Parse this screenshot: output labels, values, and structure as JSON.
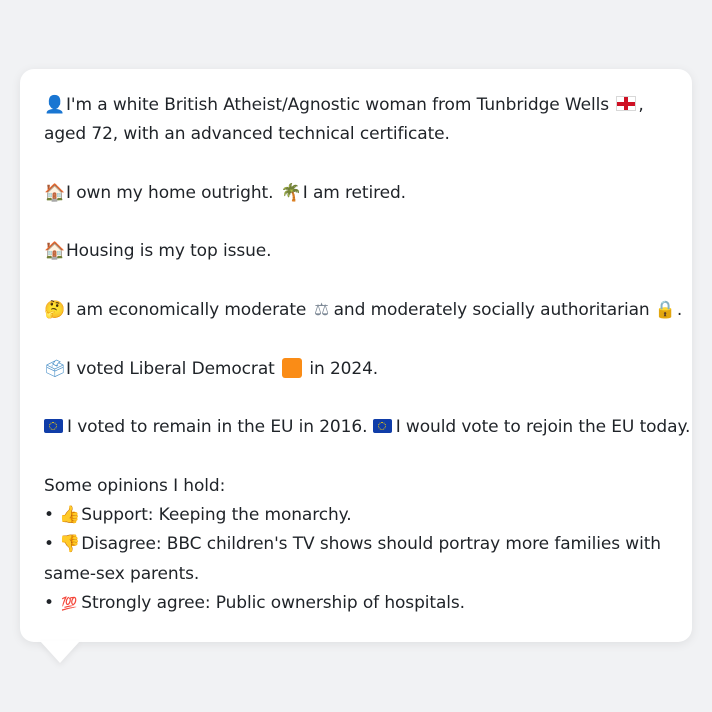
{
  "profile": {
    "line1": "I'm a white British Atheist/Agnostic woman from Tunbridge Wells",
    "line1_tail": ",",
    "line2": "aged 72, with an advanced technical certificate.",
    "home_text": "I own my home outright.",
    "retired_text": "I am retired.",
    "top_issue": "Housing is my top issue.",
    "econ_text": "I am economically moderate",
    "social_text": "and moderately socially authoritarian",
    "social_tail": ".",
    "voted_text": "I voted Liberal Democrat",
    "voted_tail": "in 2024.",
    "eu_2016": "I voted to remain in the EU in 2016.",
    "eu_today": "I would vote to rejoin the EU today.",
    "opinions_header": "Some opinions I hold:",
    "opinions": [
      {
        "bullet": "•",
        "icon": "thumbs-up-icon",
        "text": "Support: Keeping the monarchy."
      },
      {
        "bullet": "•",
        "icon": "thumbs-down-icon",
        "text": "Disagree: BBC children's TV shows should portray more families with",
        "text_cont": "same-sex parents."
      },
      {
        "bullet": "•",
        "icon": "hundred-points-icon",
        "text": "Strongly agree: Public ownership of hospitals."
      }
    ]
  },
  "colors": {
    "background": "#f1f2f4",
    "card": "#ffffff",
    "text": "#1f2328",
    "lib_dem_orange": "#fa8c16"
  }
}
